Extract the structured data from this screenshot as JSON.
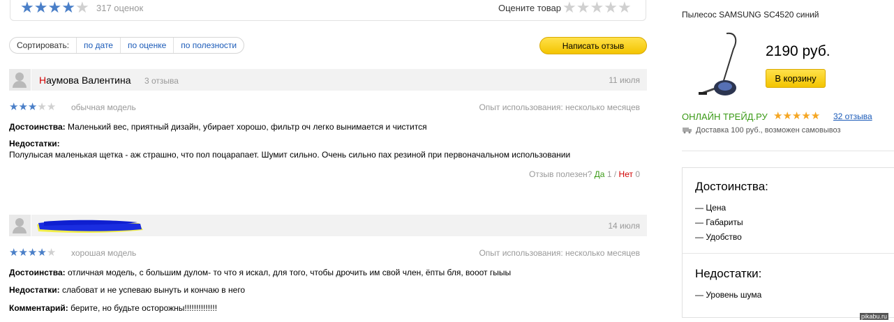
{
  "summary": {
    "rating": 4,
    "rating_max": 5,
    "ratings_count_text": "317 оценок",
    "rate_label": "Оцените товар"
  },
  "sort": {
    "label": "Сортировать:",
    "options": [
      "по дате",
      "по оценке",
      "по полезности"
    ]
  },
  "write_review_label": "Написать отзыв",
  "reviews": [
    {
      "author_first_letter": "Н",
      "author_rest": "аумова Валентина",
      "reviews_count": "3 отзыва",
      "date": "11 июля",
      "rating": 3,
      "rating_max": 5,
      "rating_text": "обычная модель",
      "usage": "Опыт использования: несколько месяцев",
      "pros_label": "Достоинства:",
      "pros": "Маленький вес, приятный дизайн, убирает хорошо, фильтр оч легко вынимается и чистится",
      "cons_label": "Недостатки:",
      "cons": "Полулысая маленькая щетка - аж страшно, что пол поцарапает. Шумит сильно. Очень сильно пах резиной при первоначальном использовании",
      "helpful_q": "Отзыв полезен?",
      "yes_label": "Да",
      "yes_count": "1",
      "slash": "/",
      "no_label": "Нет",
      "no_count": "0"
    },
    {
      "date": "14 июля",
      "rating": 4,
      "rating_max": 5,
      "rating_text": "хорошая модель",
      "usage": "Опыт использования: несколько месяцев",
      "pros_label": "Достоинства:",
      "pros": "отличная модель, с большим дулом- то что я искал, для того, чтобы дрочить им свой член, ёпты бля, вооот гыыы",
      "cons_label": "Недостатки:",
      "cons": "слабоват и не успеваю вынуть и кончаю в него",
      "comment_label": "Комментарий:",
      "comment": "берите, но будьте осторожны!!!!!!!!!!!!!!"
    }
  ],
  "offer": {
    "product_name": "Пылесос SAMSUNG SC4520 синий",
    "price": "2190 руб.",
    "cart_label": "В корзину",
    "shop_name": "ОНЛАЙН ТРЕЙД.РУ",
    "shop_rating": 5,
    "shop_reviews": "32 отзыва",
    "delivery": "Доставка 100 руб., возможен самовывоз"
  },
  "sidebar": {
    "pros_title": "Достоинства:",
    "pros": [
      "— Цена",
      "— Габариты",
      "— Удобство"
    ],
    "cons_title": "Недостатки:",
    "cons": [
      "— Уровень шума"
    ]
  },
  "watermark": "pikabu.ru",
  "colors": {
    "star_blue": "#4a7fc8",
    "star_empty": "#d0d0d0",
    "star_orange": "#f5a623",
    "shop_green": "#3a9a16",
    "link_blue": "#1a5ab8",
    "yes_green": "#3a9a16",
    "no_red": "#d10000",
    "accent_yellow": "#f7d21b"
  }
}
